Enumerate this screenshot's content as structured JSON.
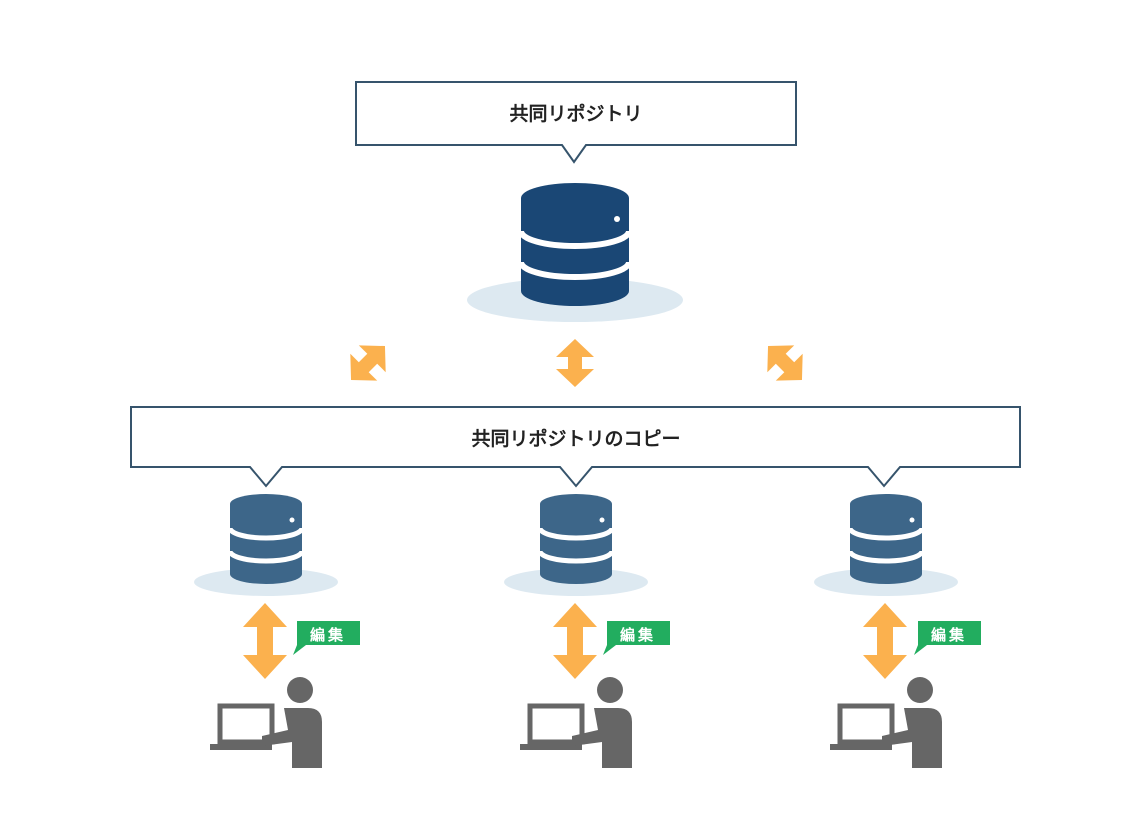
{
  "main_repository": {
    "label": "共同リポジトリ"
  },
  "copy_repository": {
    "label": "共同リポジトリのコピー"
  },
  "edit_tags": [
    {
      "label": "編集"
    },
    {
      "label": "編集"
    },
    {
      "label": "編集"
    }
  ],
  "colors": {
    "main_db": "#1a4775",
    "copy_db": "#3d6689",
    "db_shadow": "#dde9f1",
    "arrow": "#fbb14e",
    "tag": "#22ad5f",
    "person": "#666666",
    "box_border": "#36546c"
  }
}
